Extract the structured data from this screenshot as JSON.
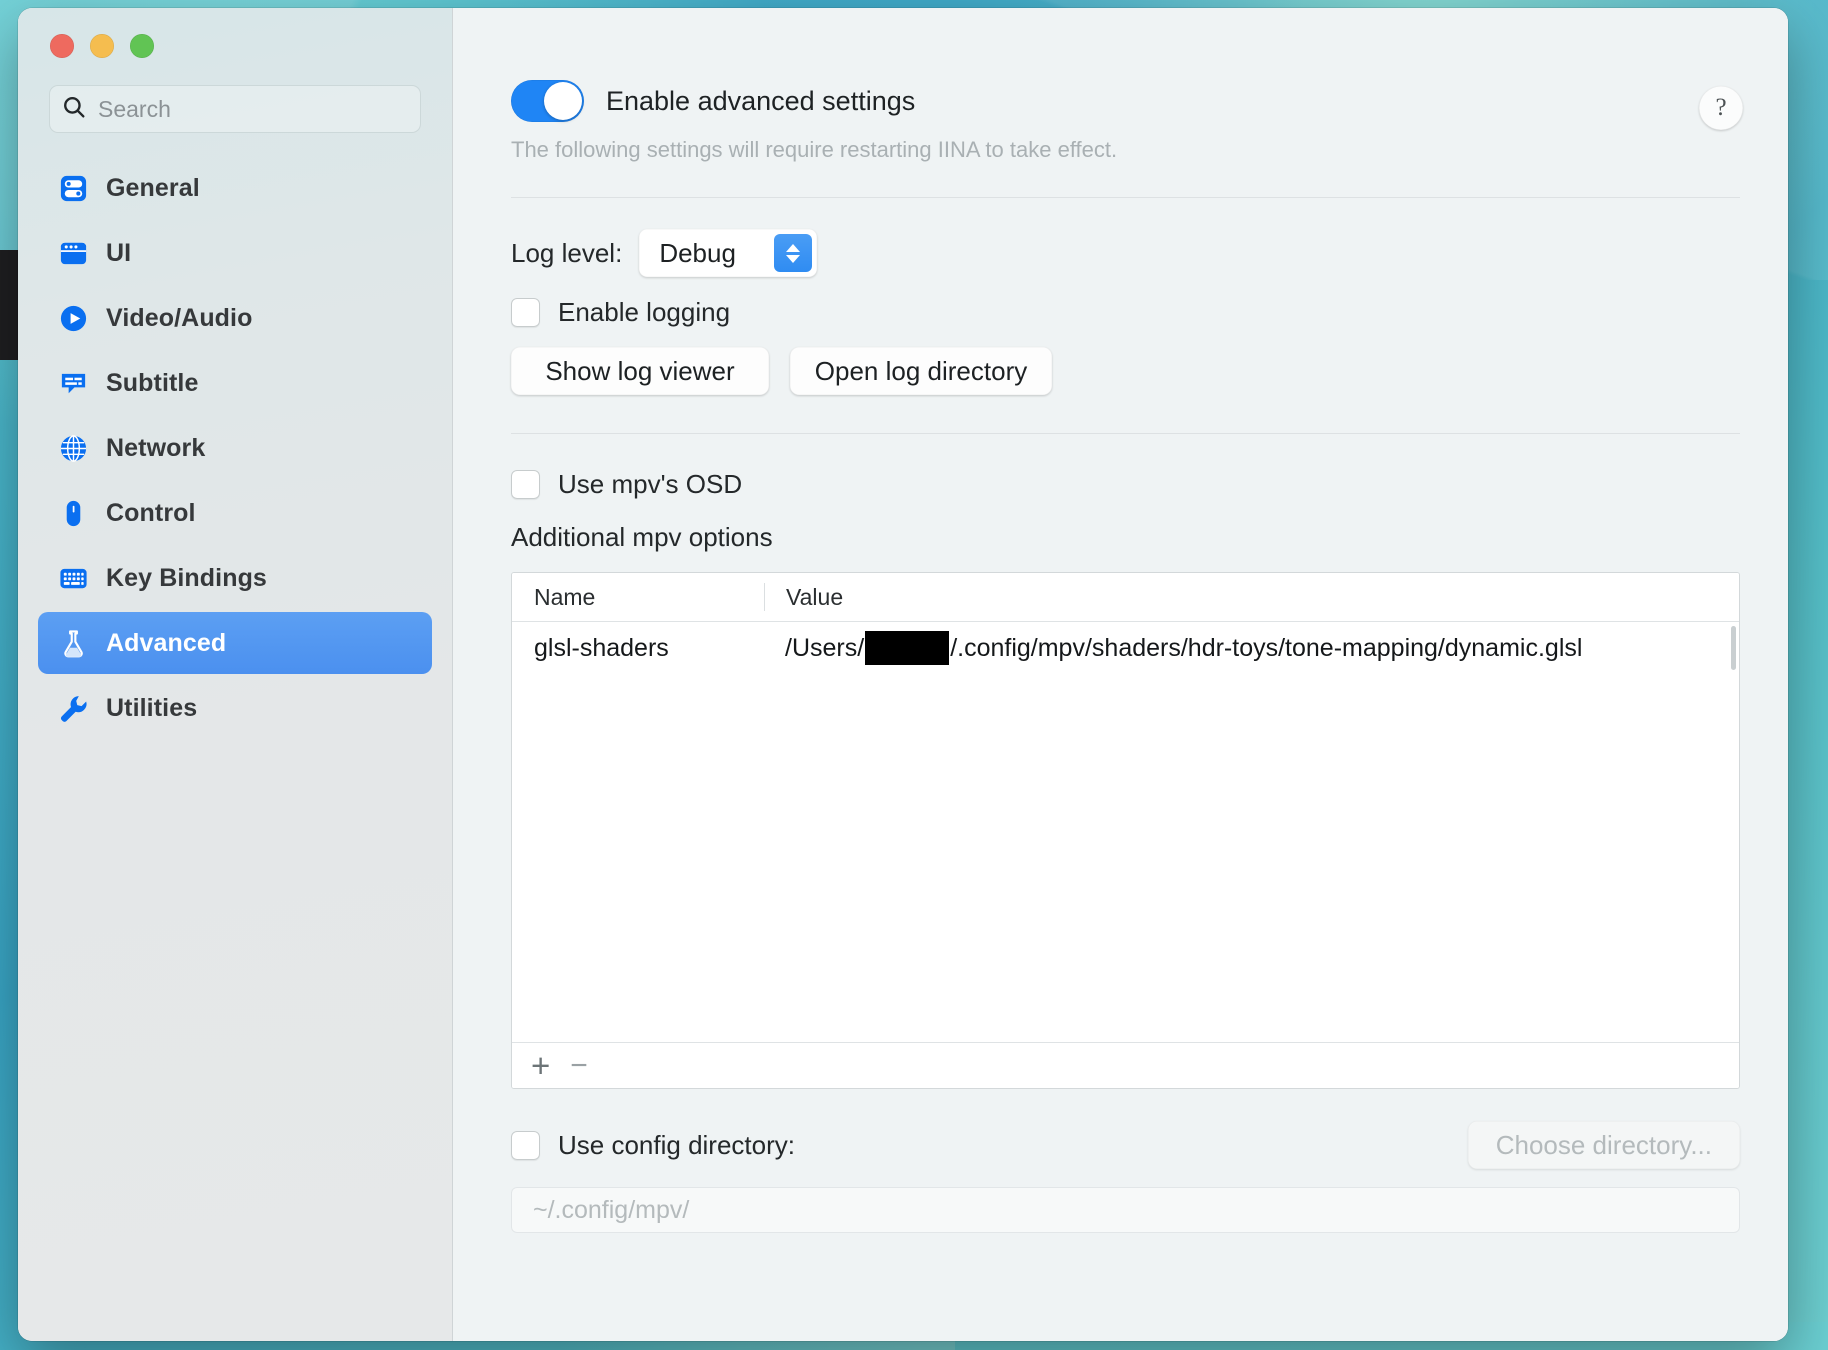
{
  "window": {
    "traffic_lights": [
      "close",
      "minimize",
      "zoom"
    ]
  },
  "search": {
    "placeholder": "Search",
    "value": "",
    "icon": "search-icon"
  },
  "sidebar": {
    "items": [
      {
        "label": "General",
        "icon": "sliders-icon",
        "selected": false
      },
      {
        "label": "UI",
        "icon": "window-icon",
        "selected": false
      },
      {
        "label": "Video/Audio",
        "icon": "play-circle-icon",
        "selected": false
      },
      {
        "label": "Subtitle",
        "icon": "subtitle-icon",
        "selected": false
      },
      {
        "label": "Network",
        "icon": "globe-icon",
        "selected": false
      },
      {
        "label": "Control",
        "icon": "mouse-icon",
        "selected": false
      },
      {
        "label": "Key Bindings",
        "icon": "keyboard-icon",
        "selected": false
      },
      {
        "label": "Advanced",
        "icon": "flask-icon",
        "selected": true
      },
      {
        "label": "Utilities",
        "icon": "wrench-icon",
        "selected": false
      }
    ]
  },
  "content": {
    "help_button": "?",
    "advanced_toggle": {
      "label": "Enable advanced settings",
      "on": true,
      "note": "The following settings will require restarting IINA to take effect."
    },
    "log": {
      "level_label": "Log level:",
      "level_value": "Debug",
      "enable_logging_label": "Enable logging",
      "enable_logging_checked": false,
      "show_log_viewer_button": "Show log viewer",
      "open_log_directory_button": "Open log directory"
    },
    "osd": {
      "label": "Use mpv's OSD",
      "checked": false
    },
    "mpv_options": {
      "section_title": "Additional mpv options",
      "columns": [
        "Name",
        "Value"
      ],
      "rows": [
        {
          "name": "glsl-shaders",
          "value_prefix": "/Users/",
          "value_redacted": true,
          "value_suffix": "/.config/mpv/shaders/hdr-toys/tone-mapping/dynamic.glsl"
        }
      ],
      "add_button": "+",
      "remove_button": "−"
    },
    "config_directory": {
      "label": "Use config directory:",
      "checked": false,
      "choose_button": "Choose directory...",
      "choose_button_disabled": true,
      "path_placeholder": "~/.config/mpv/"
    }
  },
  "colors": {
    "accent": "#1f85f5",
    "selection": "#4b90ef",
    "icon_blue": "#0a6ff0"
  }
}
